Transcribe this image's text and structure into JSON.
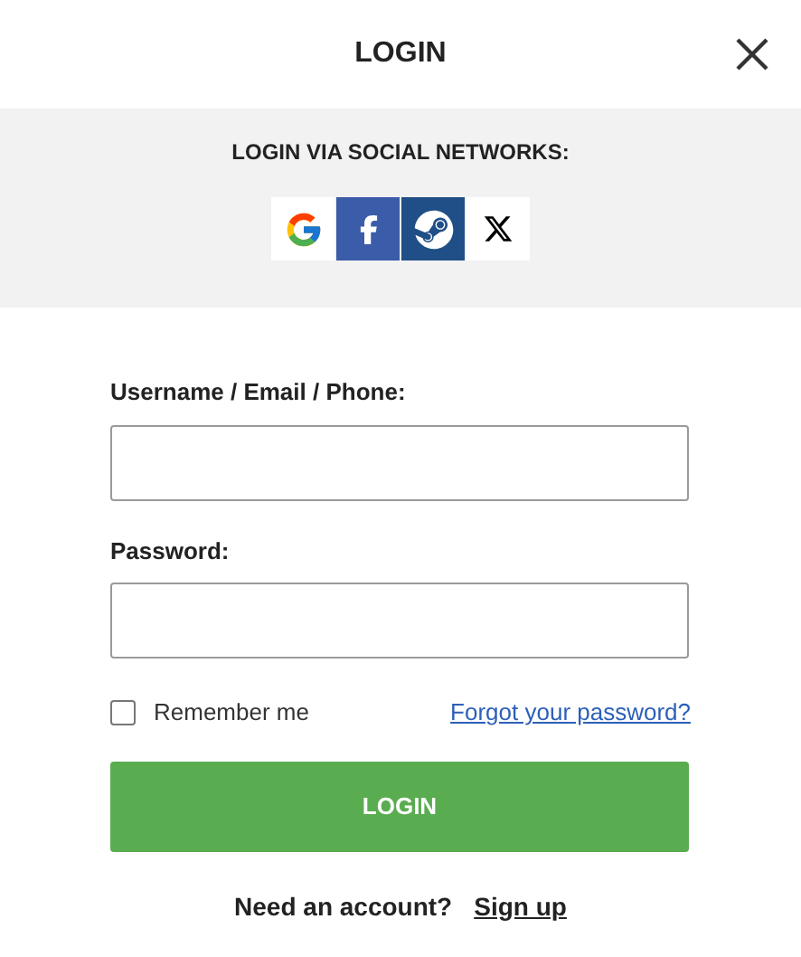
{
  "title": "LOGIN",
  "social": {
    "heading": "LOGIN VIA SOCIAL NETWORKS:",
    "providers": [
      {
        "kind": "google"
      },
      {
        "kind": "facebook"
      },
      {
        "kind": "steam"
      },
      {
        "kind": "x"
      }
    ]
  },
  "fields": [
    {
      "label": "Username / Email / Phone:"
    },
    {
      "label": "Password:"
    }
  ],
  "remember": {
    "label": "Remember me",
    "checked": false
  },
  "forgot_link": "Forgot your password?",
  "submit": "LOGIN",
  "signup": {
    "prompt": "Need an account?",
    "link": "Sign up"
  }
}
